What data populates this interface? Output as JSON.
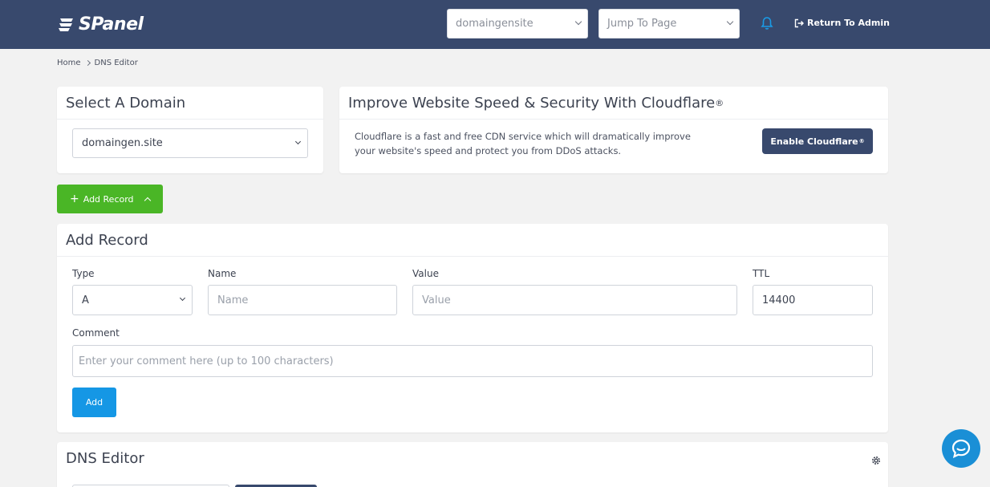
{
  "header": {
    "logo_text": "SPanel",
    "domain_select": "domaingensite",
    "jump_select": "Jump To Page",
    "return_admin": "Return To Admin"
  },
  "breadcrumb": {
    "home": "Home",
    "current": "DNS Editor"
  },
  "select_domain_card": {
    "title": "Select A Domain",
    "selected_domain": "domaingen.site"
  },
  "cloudflare_card": {
    "title": "Improve Website Speed & Security With Cloudflare",
    "title_mark": "®",
    "description": "Cloudflare is a fast and free CDN service which will dramatically improve your website's speed and protect you from DDoS attacks.",
    "button_label": "Enable Cloudflare",
    "button_mark": "®"
  },
  "add_record_toggle": "Add Record",
  "add_record_card": {
    "title": "Add Record",
    "type_label": "Type",
    "type_value": "A",
    "name_label": "Name",
    "name_placeholder": "Name",
    "value_label": "Value",
    "value_placeholder": "Value",
    "ttl_label": "TTL",
    "ttl_value": "14400",
    "comment_label": "Comment",
    "comment_placeholder": "Enter your comment here (up to 100 characters)",
    "add_button": "Add"
  },
  "dns_editor_card": {
    "title": "DNS Editor"
  },
  "colors": {
    "header_bg": "#38496d",
    "green": "#4ab626",
    "blue": "#1597e5"
  }
}
